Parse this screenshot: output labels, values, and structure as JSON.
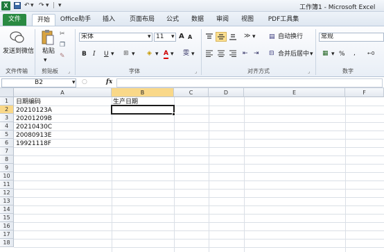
{
  "window": {
    "title": "工作簿1 - Microsoft Excel",
    "logo": "X"
  },
  "qat": {
    "save_icon": "save-icon",
    "undo_icon": "undo-icon",
    "redo_icon": "redo-icon",
    "customize": "customize-qat-icon"
  },
  "tabs": [
    "文件",
    "开始",
    "Office助手",
    "插入",
    "页面布局",
    "公式",
    "数据",
    "审阅",
    "视图",
    "PDF工具集"
  ],
  "ribbon": {
    "send_wechat": "发送到微信",
    "paste": "粘贴",
    "group_file_transfer": "文件传输",
    "group_clipboard": "剪贴板",
    "font_name": "宋体",
    "font_size": "11",
    "group_font": "字体",
    "wrap_text": "自动换行",
    "merge_center": "合并后居中",
    "group_alignment": "对齐方式",
    "number_format": "常规",
    "group_number": "数字",
    "bold": "B",
    "italic": "I",
    "underline": "U",
    "grow_font": "A",
    "shrink_font": "A",
    "percent": "%"
  },
  "formula_bar": {
    "name_box": "B2",
    "fx": "fx",
    "content": ""
  },
  "columns": [
    "A",
    "B",
    "C",
    "D",
    "E",
    "F"
  ],
  "rows": [
    "1",
    "2",
    "3",
    "4",
    "5",
    "6",
    "7",
    "8",
    "9",
    "10",
    "11",
    "12",
    "13",
    "14",
    "15",
    "16",
    "17",
    "18"
  ],
  "cells": {
    "A1": "日期编码",
    "B1": "生产日期",
    "A2": "20210123A",
    "A3": "20201209B",
    "A4": "20210430C",
    "A5": "20080913E",
    "A6": "19921118F"
  },
  "selected_cell": "B2"
}
